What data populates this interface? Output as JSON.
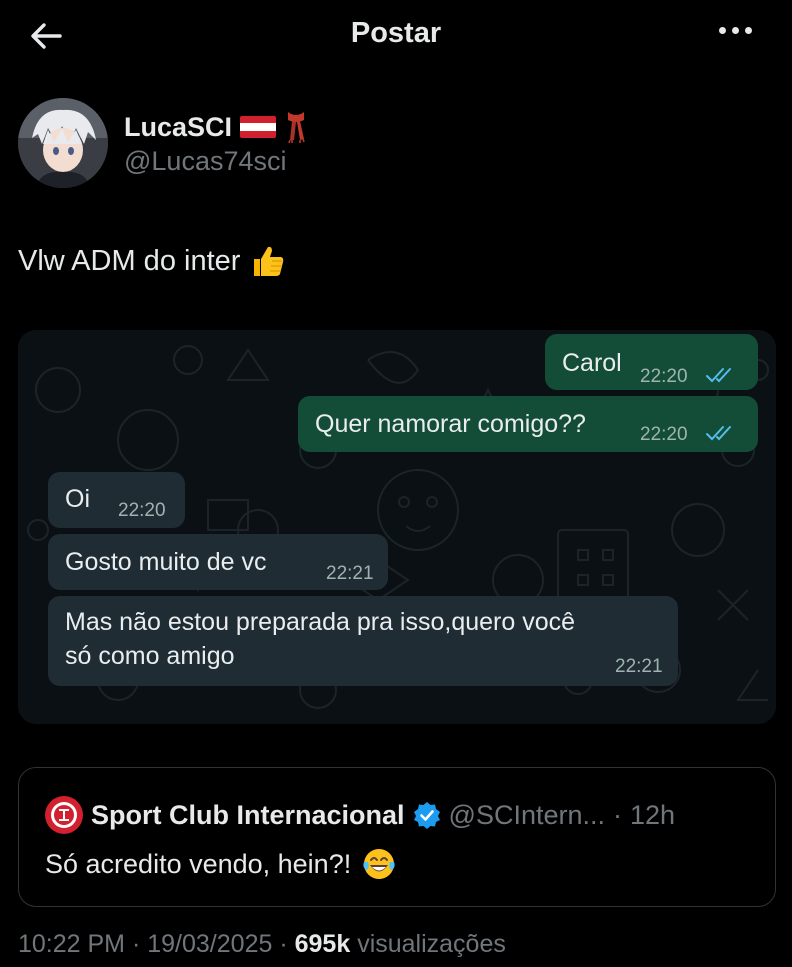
{
  "header": {
    "title": "Postar",
    "back_icon": "arrow-left-icon",
    "more_icon": "more-horizontal-icon"
  },
  "author": {
    "name": "LucaSCI",
    "handle": "@Lucas74sci",
    "flag_colors": [
      "#d2202f",
      "#ffffff",
      "#d2202f"
    ],
    "emoji": "🧣"
  },
  "tweet": {
    "text": "Vlw ADM do inter",
    "emoji": "👍"
  },
  "chat": {
    "messages": [
      {
        "direction": "out",
        "text": "Carol",
        "time": "22:20",
        "read": true
      },
      {
        "direction": "out",
        "text": "Quer namorar comigo??",
        "time": "22:20",
        "read": true
      },
      {
        "direction": "in",
        "text": "Oi",
        "time": "22:20"
      },
      {
        "direction": "in",
        "text": "Gosto muito de vc",
        "time": "22:21"
      },
      {
        "direction": "in",
        "text_line1": "Mas não estou preparada pra isso,quero você",
        "text_line2": "só como amigo",
        "time": "22:21"
      }
    ],
    "colors": {
      "outgoing": "#134d37",
      "incoming": "#1f2c34",
      "read_ticks": "#53bdeb"
    }
  },
  "quote": {
    "name": "Sport Club Internacional",
    "handle": "@SCIntern...",
    "separator": "·",
    "age": "12h",
    "text": "Só acredito vendo, hein?!",
    "emoji": "😂",
    "logo_color": "#d2202f",
    "verified_color": "#1d9bf0"
  },
  "meta": {
    "time": "10:22 PM",
    "date": "19/03/2025",
    "dot": "·",
    "views": "695k",
    "views_label": "visualizações"
  }
}
